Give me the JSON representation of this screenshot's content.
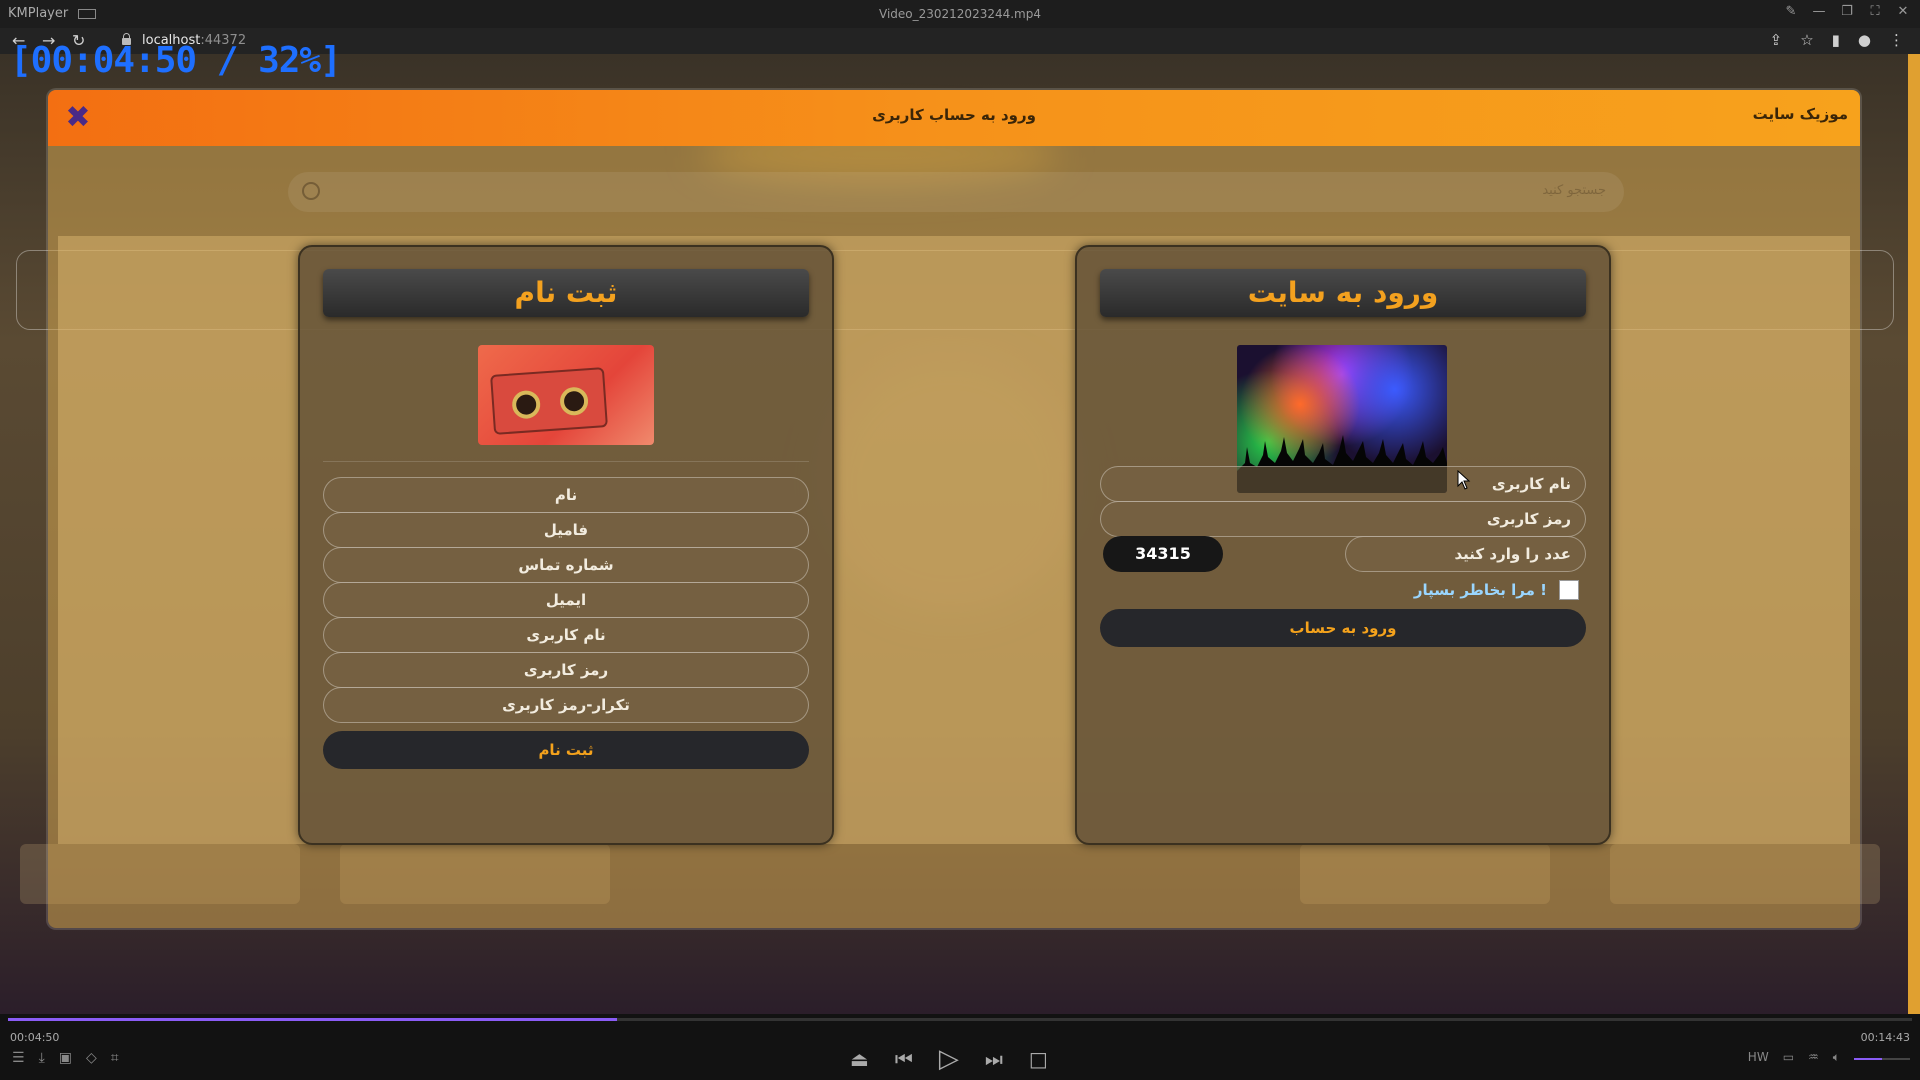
{
  "player": {
    "app_name": "KMPlayer",
    "file_name": "Video_230212023244.mp4",
    "timecode_overlay": "[00:04:50 / 32%]",
    "time_current": "00:04:50",
    "time_total": "00:14:43",
    "progress_percent": 32,
    "volume_fraction": 0.5
  },
  "browser": {
    "host": "localhost",
    "port": ":44372"
  },
  "modal": {
    "title": "ورود به حساب کاربری",
    "site_name": "موزیک سایت",
    "search_placeholder": "جستجو کنید"
  },
  "register": {
    "heading": "ثبت نام",
    "fields": [
      "نام",
      "فامیل",
      "شماره تماس",
      "ایمیل",
      "نام کاربری",
      "رمز کاربری",
      "تکرار-رمز کاربری"
    ],
    "submit_label": "ثبت نام"
  },
  "login": {
    "heading": "ورود به سایت",
    "username_placeholder": "نام کاربری",
    "password_placeholder": "رمز کاربری",
    "captcha_placeholder": "عدد را وارد کنید",
    "captcha_code": "34315",
    "remember_label": "مرا بخاطر بسپار !",
    "remember_checked": false,
    "submit_label": "ورود به حساب"
  },
  "colors": {
    "header_orange": "#f36f12",
    "accent_yellow": "#f4a21c",
    "close_purple": "#4a2a87",
    "timecode_blue": "#1e6fff",
    "progress_purple": "#8a5cf5"
  }
}
